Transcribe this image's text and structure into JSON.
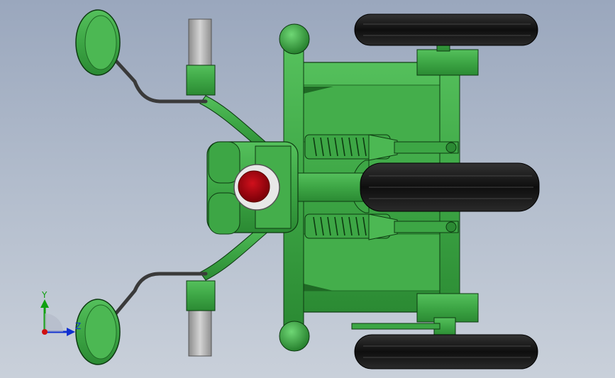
{
  "viewport": {
    "background_top": "#9aa7bd",
    "background_bottom": "#c9d0da"
  },
  "model": {
    "body_color": "#3da645",
    "body_dark": "#1f6a25",
    "tire_color": "#111111",
    "lens_color": "#b0000c",
    "pipe_color": "#a9a9a9"
  },
  "triad": {
    "x_label": "",
    "y_label": "Y",
    "z_label": "Z",
    "x_color": "#d01010",
    "y_color": "#10a010",
    "z_color": "#1030d0"
  }
}
